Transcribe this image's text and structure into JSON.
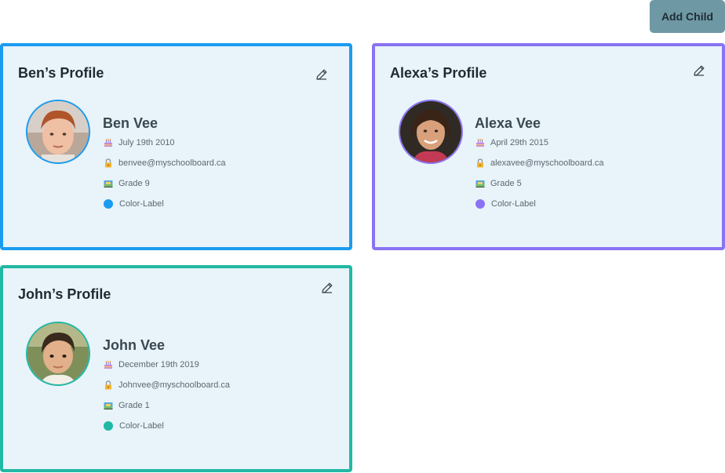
{
  "header": {
    "add_child_label": "Add Child"
  },
  "profiles": [
    {
      "title": "Ben’s Profile",
      "name": "Ben Vee",
      "birthday": "July 19th 2010",
      "email": "benvee@myschoolboard.ca",
      "grade": "Grade 9",
      "color_label": "Color-Label",
      "color": "#1a9cf0",
      "avatar_icon": "boy-photo"
    },
    {
      "title": "Alexa’s Profile",
      "name": "Alexa Vee",
      "birthday": "April 29th 2015",
      "email": "alexavee@myschoolboard.ca",
      "grade": "Grade 5",
      "color_label": "Color-Label",
      "color": "#8a73f2",
      "avatar_icon": "girl-photo"
    },
    {
      "title": "John’s Profile",
      "name": "John Vee",
      "birthday": "December 19th 2019",
      "email": "Johnvee@myschoolboard.ca",
      "grade": "Grade 1",
      "color_label": "Color-Label",
      "color": "#21b8a4",
      "avatar_icon": "toddler-photo"
    }
  ],
  "icons": {
    "edit": "pencil-icon",
    "birthday": "cake-icon",
    "email": "lock-icon",
    "grade": "school-icon"
  }
}
